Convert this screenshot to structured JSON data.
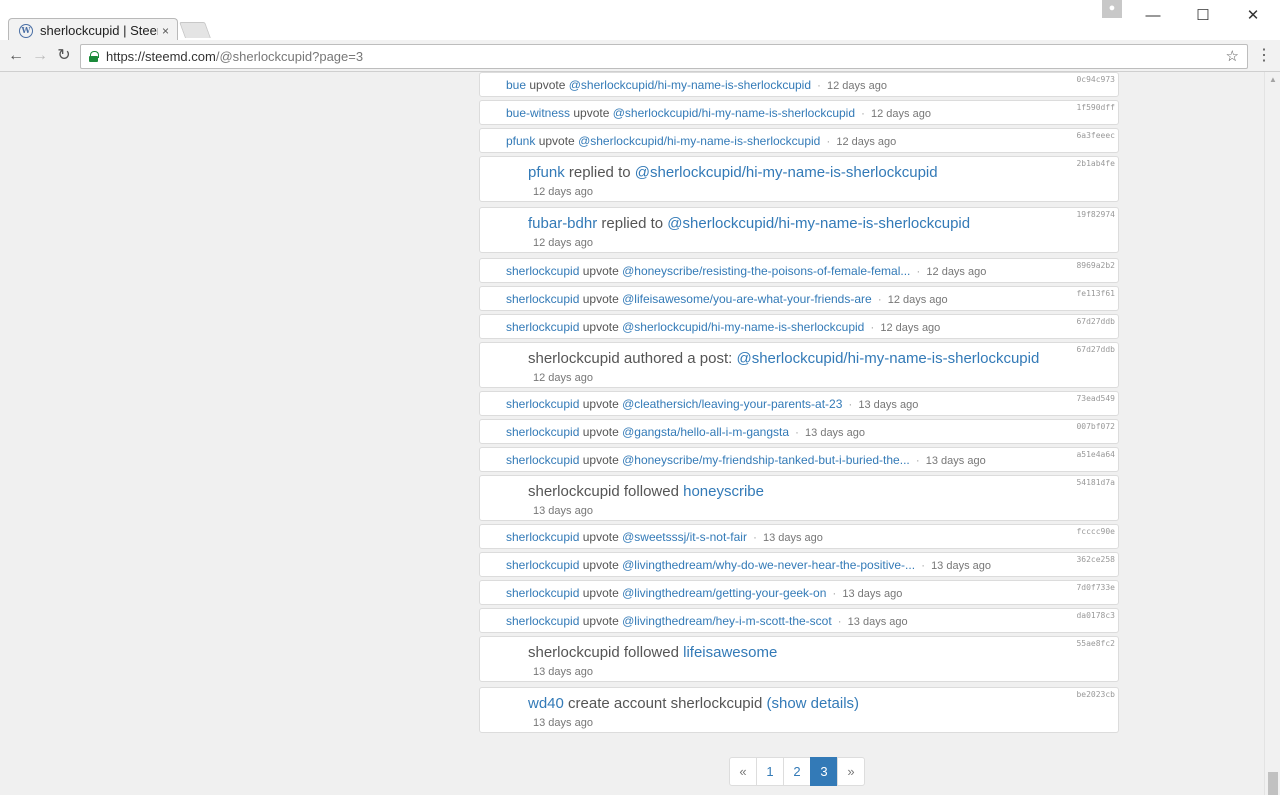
{
  "browser": {
    "tab_title": "sherlockcupid | Steemd",
    "tab_close": "×",
    "url_host": "https://steemd.com",
    "url_path": "/@sherlockcupid?page=3"
  },
  "feed": [
    {
      "kind": "small",
      "user": "bue",
      "action": "upvote",
      "link": "@sherlockcupid/hi-my-name-is-sherlockcupid",
      "time": "12 days ago",
      "hash": "0c94c973"
    },
    {
      "kind": "small",
      "user": "bue-witness",
      "action": "upvote",
      "link": "@sherlockcupid/hi-my-name-is-sherlockcupid",
      "time": "12 days ago",
      "hash": "1f590dff"
    },
    {
      "kind": "small",
      "user": "pfunk",
      "action": "upvote",
      "link": "@sherlockcupid/hi-my-name-is-sherlockcupid",
      "time": "12 days ago",
      "hash": "6a3feeec"
    },
    {
      "kind": "big",
      "user": "pfunk",
      "action": "replied to",
      "link": "@sherlockcupid/hi-my-name-is-sherlockcupid",
      "time": "12 days ago",
      "hash": "2b1ab4fe"
    },
    {
      "kind": "big",
      "user": "fubar-bdhr",
      "action": "replied to",
      "link": "@sherlockcupid/hi-my-name-is-sherlockcupid",
      "time": "12 days ago",
      "hash": "19f82974"
    },
    {
      "kind": "small",
      "user": "sherlockcupid",
      "action": "upvote",
      "link": "@honeyscribe/resisting-the-poisons-of-female-femal...",
      "time": "12 days ago",
      "hash": "8969a2b2"
    },
    {
      "kind": "small",
      "user": "sherlockcupid",
      "action": "upvote",
      "link": "@lifeisawesome/you-are-what-your-friends-are",
      "time": "12 days ago",
      "hash": "fe113f61"
    },
    {
      "kind": "small",
      "user": "sherlockcupid",
      "action": "upvote",
      "link": "@sherlockcupid/hi-my-name-is-sherlockcupid",
      "time": "12 days ago",
      "hash": "67d27ddb"
    },
    {
      "kind": "big",
      "user": "sherlockcupid",
      "action": "authored a post:",
      "link": "@sherlockcupid/hi-my-name-is-sherlockcupid",
      "time": "12 days ago",
      "hash": "67d27ddb",
      "plain_user": true
    },
    {
      "kind": "small",
      "user": "sherlockcupid",
      "action": "upvote",
      "link": "@cleathersich/leaving-your-parents-at-23",
      "time": "13 days ago",
      "hash": "73ead549"
    },
    {
      "kind": "small",
      "user": "sherlockcupid",
      "action": "upvote",
      "link": "@gangsta/hello-all-i-m-gangsta",
      "time": "13 days ago",
      "hash": "007bf072"
    },
    {
      "kind": "small",
      "user": "sherlockcupid",
      "action": "upvote",
      "link": "@honeyscribe/my-friendship-tanked-but-i-buried-the...",
      "time": "13 days ago",
      "hash": "a51e4a64"
    },
    {
      "kind": "big",
      "user": "sherlockcupid",
      "action": "followed",
      "link": "honeyscribe",
      "time": "13 days ago",
      "hash": "54181d7a",
      "plain_user": true
    },
    {
      "kind": "small",
      "user": "sherlockcupid",
      "action": "upvote",
      "link": "@sweetsssj/it-s-not-fair",
      "time": "13 days ago",
      "hash": "fcccc90e"
    },
    {
      "kind": "small",
      "user": "sherlockcupid",
      "action": "upvote",
      "link": "@livingthedream/why-do-we-never-hear-the-positive-...",
      "time": "13 days ago",
      "hash": "362ce258"
    },
    {
      "kind": "small",
      "user": "sherlockcupid",
      "action": "upvote",
      "link": "@livingthedream/getting-your-geek-on",
      "time": "13 days ago",
      "hash": "7d0f733e"
    },
    {
      "kind": "small",
      "user": "sherlockcupid",
      "action": "upvote",
      "link": "@livingthedream/hey-i-m-scott-the-scot",
      "time": "13 days ago",
      "hash": "da0178c3"
    },
    {
      "kind": "big",
      "user": "sherlockcupid",
      "action": "followed",
      "link": "lifeisawesome",
      "time": "13 days ago",
      "hash": "55ae8fc2",
      "plain_user": true
    },
    {
      "kind": "big",
      "user": "wd40",
      "action": "create account sherlockcupid",
      "link": "(show details)",
      "time": "13 days ago",
      "hash": "be2023cb"
    }
  ],
  "pagination": {
    "prev": "«",
    "pages": [
      "1",
      "2",
      "3"
    ],
    "active": "3",
    "next": "»"
  }
}
